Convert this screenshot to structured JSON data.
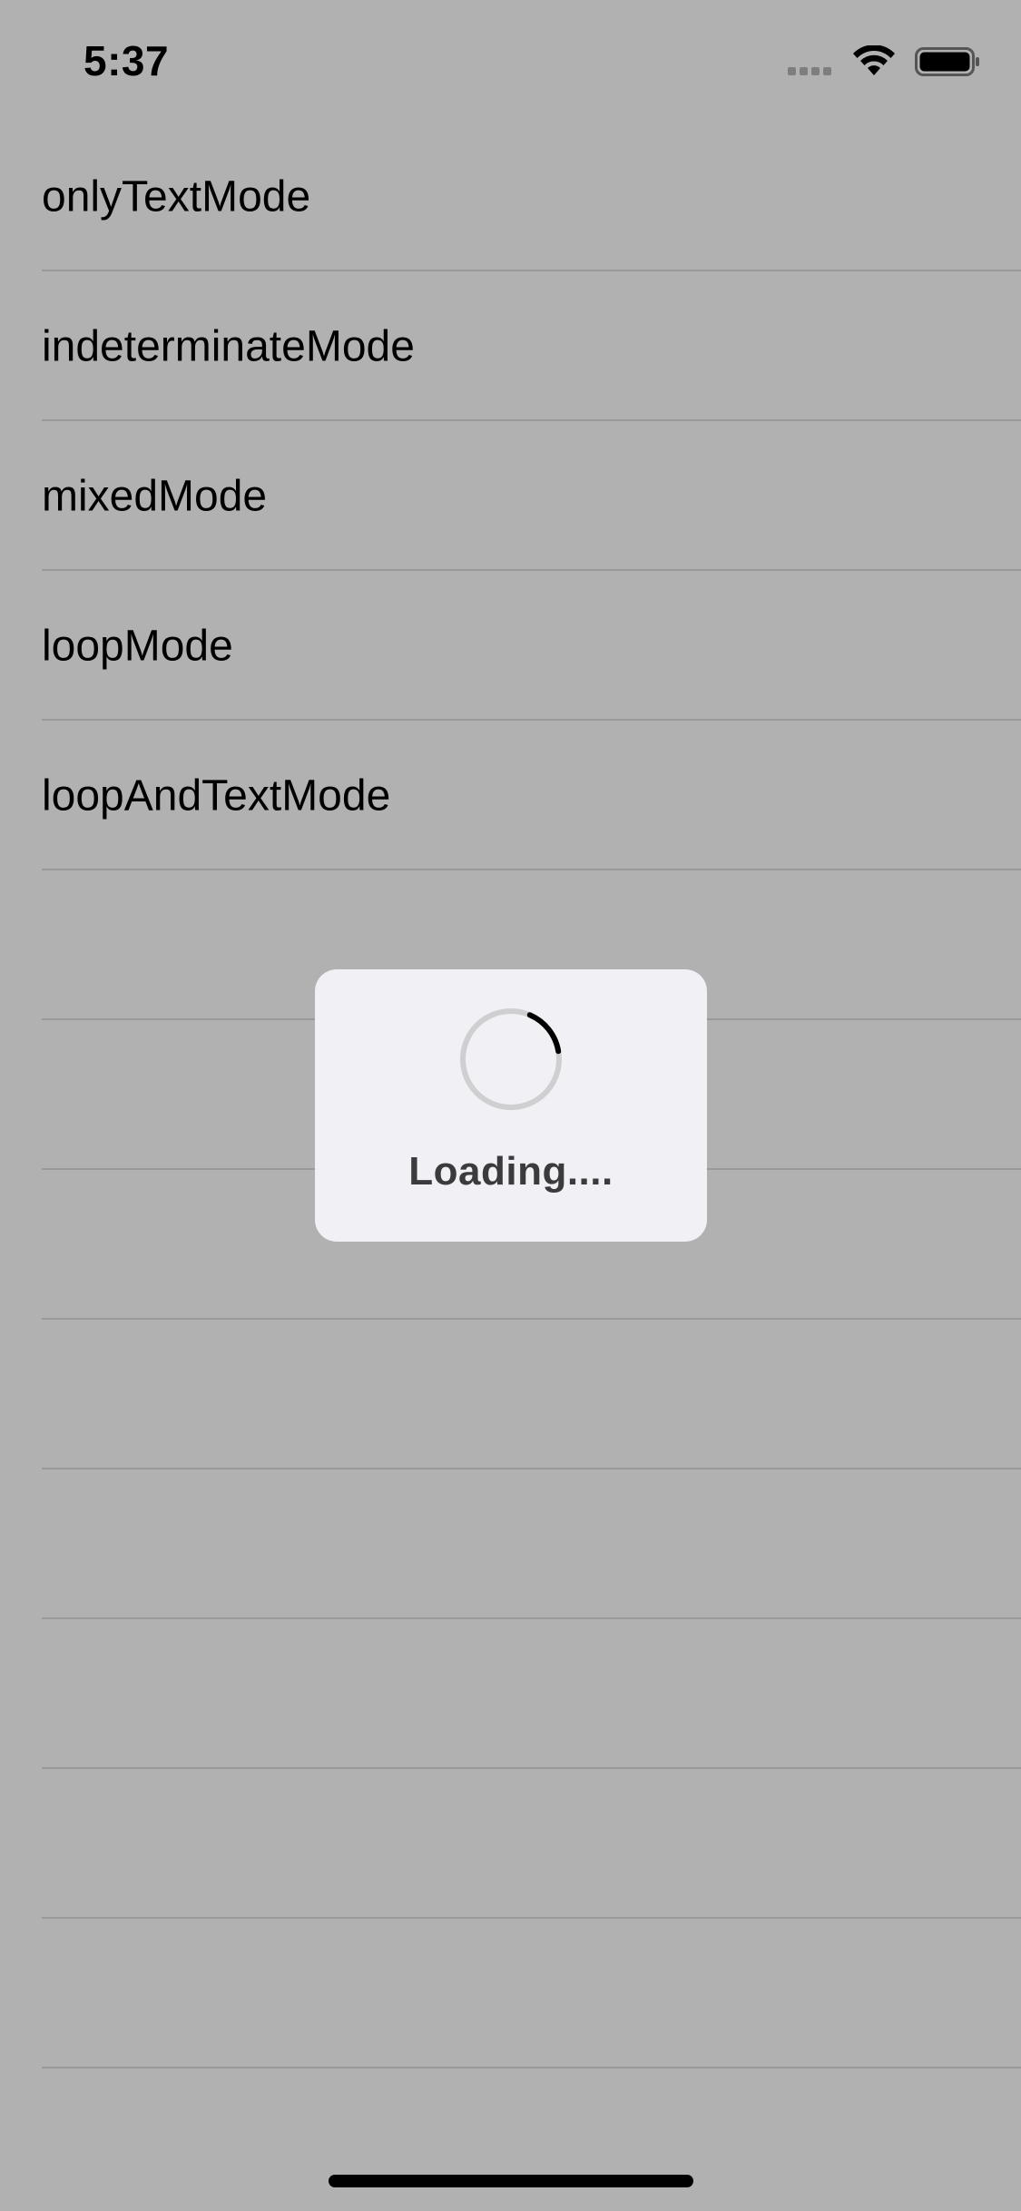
{
  "status_bar": {
    "time": "5:37",
    "icons": [
      "signal-icon",
      "wifi-icon",
      "battery-icon"
    ]
  },
  "list": {
    "items": [
      {
        "label": "onlyTextMode"
      },
      {
        "label": "indeterminateMode"
      },
      {
        "label": "mixedMode"
      },
      {
        "label": "loopMode"
      },
      {
        "label": "loopAndTextMode"
      },
      {
        "label": ""
      },
      {
        "label": ""
      },
      {
        "label": ""
      },
      {
        "label": ""
      },
      {
        "label": ""
      },
      {
        "label": ""
      },
      {
        "label": ""
      },
      {
        "label": ""
      }
    ]
  },
  "hud": {
    "text": "Loading....",
    "spinner_icon": "activity-spinner-icon"
  },
  "colors": {
    "dimmed_background": "#b1b1b1",
    "separator": "#999999",
    "hud_background": "#f0f0f5",
    "hud_text": "#3b3b3e"
  }
}
